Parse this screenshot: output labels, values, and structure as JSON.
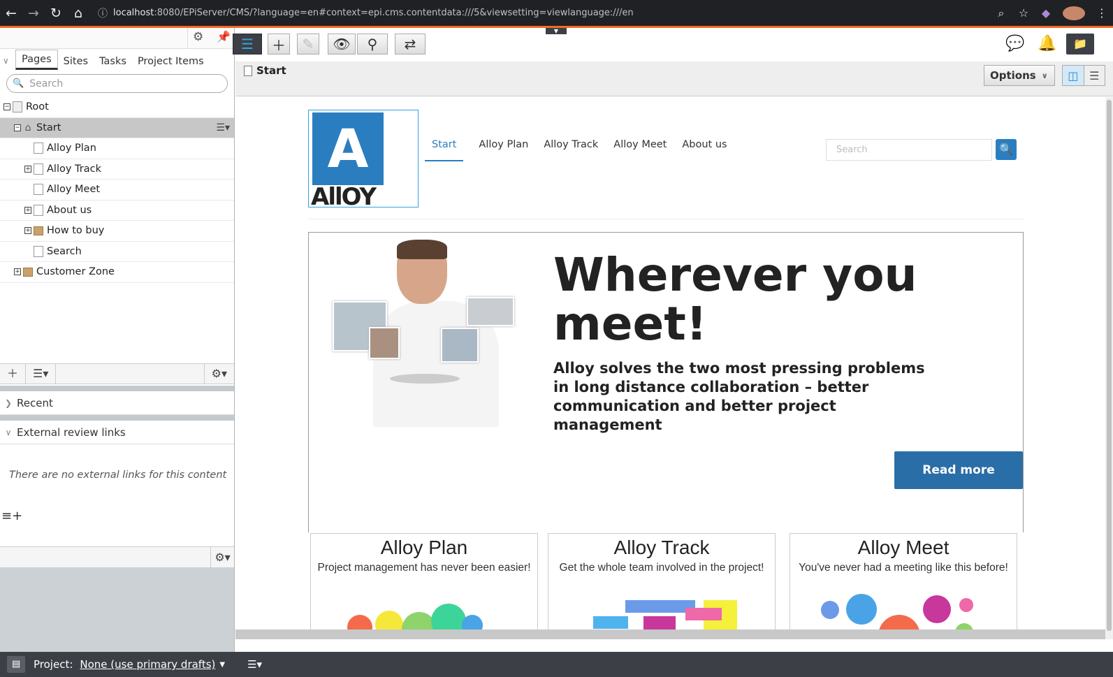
{
  "browser": {
    "url_host": "localhost",
    "url_rest": ":8080/EPiServer/CMS/?language=en#context=epi.cms.contentdata:///5&viewsetting=viewlanguage:///en"
  },
  "left_pane": {
    "tabs": [
      "Pages",
      "Sites",
      "Tasks",
      "Project Items"
    ],
    "search_placeholder": "Search",
    "tree": [
      {
        "label": "Root",
        "level": 0,
        "expander": "minus",
        "icon": "root-icon"
      },
      {
        "label": "Start",
        "level": 1,
        "expander": "minus",
        "icon": "home-icon",
        "selected": true
      },
      {
        "label": "Alloy Plan",
        "level": 2,
        "expander": "none",
        "icon": "page-icon"
      },
      {
        "label": "Alloy Track",
        "level": 2,
        "expander": "plus",
        "icon": "page-icon"
      },
      {
        "label": "Alloy Meet",
        "level": 2,
        "expander": "none",
        "icon": "page-icon"
      },
      {
        "label": "About us",
        "level": 2,
        "expander": "plus",
        "icon": "page-icon"
      },
      {
        "label": "How to buy",
        "level": 2,
        "expander": "plus",
        "icon": "folder-icon"
      },
      {
        "label": "Search",
        "level": 2,
        "expander": "none",
        "icon": "page-icon"
      },
      {
        "label": "Customer Zone",
        "level": 1,
        "expander": "plus",
        "icon": "folder-icon"
      }
    ],
    "recent_label": "Recent",
    "external_links_label": "External review links",
    "no_links_text": "There are no external links for this content"
  },
  "toolbar": {
    "breadcrumb_title": "Start",
    "options_label": "Options"
  },
  "site": {
    "logo_letter": "A",
    "logo_word": "AllOY",
    "nav": [
      "Start",
      "Alloy Plan",
      "Alloy Track",
      "Alloy Meet",
      "About us"
    ],
    "search_placeholder": "Search",
    "hero_title": "Wherever you meet!",
    "hero_subtitle": "Alloy solves the two most pressing problems in long distance collaboration – better communication and better project management",
    "read_more": "Read more",
    "cards": [
      {
        "title": "Alloy Plan",
        "text": "Project management has never been easier!"
      },
      {
        "title": "Alloy Track",
        "text": "Get the whole team involved in the project!"
      },
      {
        "title": "Alloy Meet",
        "text": "You've never had a meeting like this before!"
      }
    ]
  },
  "bottom_bar": {
    "project_label": "Project:",
    "project_value": "None (use primary drafts)"
  },
  "colors": {
    "accent": "#2a7ec0",
    "browser_line": "#f06b27",
    "dark_bar": "#3c3f45"
  }
}
